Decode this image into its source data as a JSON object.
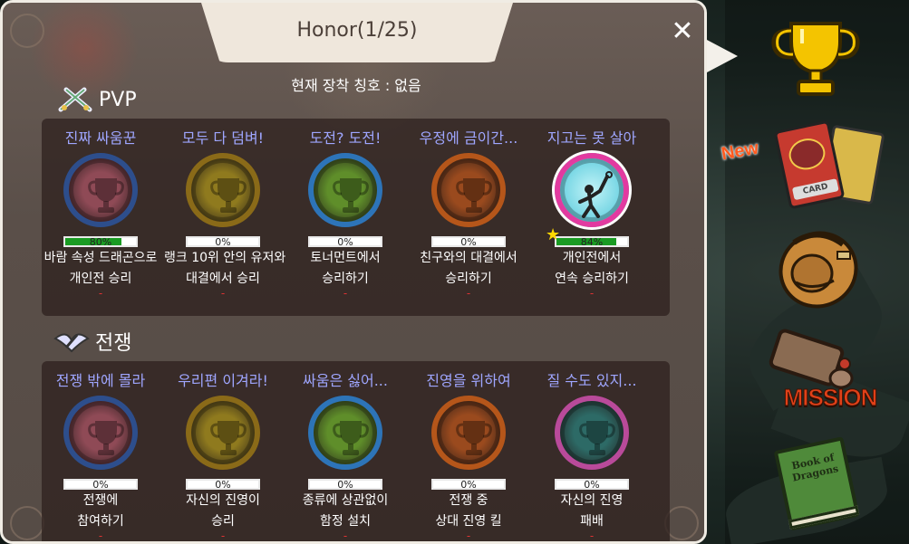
{
  "title": "Honor(1/25)",
  "equipped_text": "현재 장착 칭호 : 없음",
  "sections": [
    {
      "heading": "PVP",
      "items": [
        {
          "name": "진짜 싸움꾼",
          "progress": "80%",
          "fill": 0.8,
          "desc1": "바람 속성 드래곤으로",
          "desc2": "개인전 승리",
          "medal": "#8f4a56",
          "ring": "#2d4e8c"
        },
        {
          "name": "모두 다 덤벼!",
          "progress": "0%",
          "fill": 0,
          "desc1": "랭크 10위 안의 유저와",
          "desc2": "대결에서 승리",
          "medal": "#8f7a1e",
          "ring": "#8a6a18"
        },
        {
          "name": "도전? 도전!",
          "progress": "0%",
          "fill": 0,
          "desc1": "토너먼트에서",
          "desc2": "승리하기",
          "medal": "#5f8e2a",
          "ring": "#2d74b8"
        },
        {
          "name": "우정에 금이간...",
          "progress": "0%",
          "fill": 0,
          "desc1": "친구와의 대결에서",
          "desc2": "승리하기",
          "medal": "#9a4a1e",
          "ring": "#b5561a"
        },
        {
          "name": "지고는 못 살아",
          "progress": "84%",
          "fill": 0.84,
          "desc1": "개인전에서",
          "desc2": "연속 승리하기",
          "medal": "#6fd3e2",
          "ring": "#e23aa0",
          "special": true
        }
      ]
    },
    {
      "heading": "전쟁",
      "items": [
        {
          "name": "전쟁 밖에 몰라",
          "progress": "0%",
          "fill": 0,
          "desc1": "전쟁에",
          "desc2": "참여하기",
          "medal": "#8f4a56",
          "ring": "#2d4e8c"
        },
        {
          "name": "우리편 이겨라!",
          "progress": "0%",
          "fill": 0,
          "desc1": "자신의 진영이",
          "desc2": "승리",
          "medal": "#8f7a1e",
          "ring": "#8a6a18"
        },
        {
          "name": "싸움은 싫어...",
          "progress": "0%",
          "fill": 0,
          "desc1": "종류에 상관없이",
          "desc2": "함정 설치",
          "medal": "#5f8e2a",
          "ring": "#2d74b8"
        },
        {
          "name": "진영을 위하여",
          "progress": "0%",
          "fill": 0,
          "desc1": "전쟁 중",
          "desc2": "상대 진영 킬",
          "medal": "#9a4a1e",
          "ring": "#b5561a"
        },
        {
          "name": "질 수도 있지...",
          "progress": "0%",
          "fill": 0,
          "desc1": "자신의 진영",
          "desc2": "패배",
          "medal": "#2d6a66",
          "ring": "#b94a9a"
        }
      ]
    }
  ],
  "side": {
    "new_badge": "New",
    "card_label": "CARD",
    "mission_label": "MISSION",
    "book_label": "Book of Dragons"
  }
}
